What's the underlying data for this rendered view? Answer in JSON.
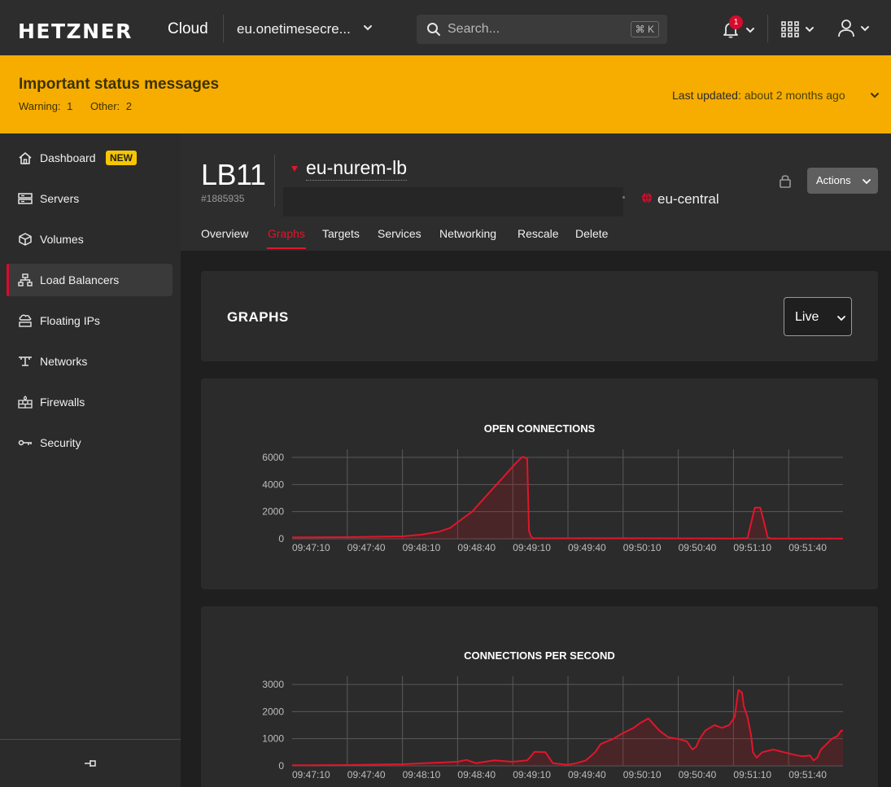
{
  "topbar": {
    "logo": "HETZNER",
    "product": "Cloud",
    "project": "eu.onetimesecre...",
    "search_placeholder": "Search...",
    "search_shortcut": "⌘ K",
    "notification_count": "1"
  },
  "banner": {
    "title": "Important status messages",
    "warning_label": "Warning:",
    "warning_count": "1",
    "other_label": "Other:",
    "other_count": "2",
    "updated_label": "Last updated:",
    "updated_value": "about 2 months ago"
  },
  "sidebar": {
    "items": [
      {
        "label": "Dashboard",
        "icon": "home-icon",
        "badge": "NEW"
      },
      {
        "label": "Servers",
        "icon": "server-icon"
      },
      {
        "label": "Volumes",
        "icon": "cube-icon"
      },
      {
        "label": "Load Balancers",
        "icon": "load-balancer-icon",
        "active": true
      },
      {
        "label": "Floating IPs",
        "icon": "floating-ip-icon"
      },
      {
        "label": "Networks",
        "icon": "network-icon"
      },
      {
        "label": "Firewalls",
        "icon": "firewall-icon"
      },
      {
        "label": "Security",
        "icon": "key-icon"
      }
    ]
  },
  "header": {
    "type": "LB11",
    "id": "#1885935",
    "name": "eu-nurem-lb",
    "location": "eu-central",
    "actions_label": "Actions",
    "tabs": [
      "Overview",
      "Graphs",
      "Targets",
      "Services",
      "Networking",
      "Rescale",
      "Delete"
    ],
    "active_tab": "Graphs"
  },
  "graphs": {
    "title": "GRAPHS",
    "range": "Live"
  },
  "colors": {
    "accent": "#d50c2d",
    "banner": "#f7ac00",
    "line": "#e0162b"
  },
  "chart_data": [
    {
      "type": "area",
      "title": "OPEN CONNECTIONS",
      "x": [
        "09:47:10",
        "09:47:40",
        "09:48:10",
        "09:48:40",
        "09:49:10",
        "09:49:40",
        "09:50:10",
        "09:50:40",
        "09:51:10",
        "09:51:40"
      ],
      "ytick_labels": [
        "0",
        "2000",
        "4000",
        "6000"
      ],
      "ylim": [
        0,
        6000
      ],
      "grid": true,
      "series": [
        {
          "points": [
            [
              0,
              100
            ],
            [
              30,
              120
            ],
            [
              60,
              180
            ],
            [
              70,
              300
            ],
            [
              80,
              520
            ],
            [
              86,
              800
            ],
            [
              90,
              1200
            ],
            [
              94,
              1600
            ],
            [
              98,
              2000
            ],
            [
              102,
              2600
            ],
            [
              106,
              3200
            ],
            [
              110,
              3800
            ],
            [
              114,
              4400
            ],
            [
              118,
              5000
            ],
            [
              122,
              5600
            ],
            [
              125,
              6000
            ],
            [
              126,
              6050
            ],
            [
              128,
              5900
            ],
            [
              129,
              600
            ],
            [
              130,
              200
            ],
            [
              131,
              50
            ],
            [
              240,
              20
            ],
            [
              248,
              50
            ],
            [
              250,
              1200
            ],
            [
              252,
              2300
            ],
            [
              255,
              2300
            ],
            [
              257,
              1200
            ],
            [
              259,
              100
            ],
            [
              261,
              20
            ],
            [
              300,
              20
            ]
          ]
        }
      ]
    },
    {
      "type": "area",
      "title": "CONNECTIONS PER SECOND",
      "x": [
        "09:47:10",
        "09:47:40",
        "09:48:10",
        "09:48:40",
        "09:49:10",
        "09:49:40",
        "09:50:10",
        "09:50:40",
        "09:51:10",
        "09:51:40"
      ],
      "ytick_labels": [
        "0",
        "1000",
        "2000",
        "3000"
      ],
      "ylim": [
        0,
        3000
      ],
      "grid": true,
      "series": [
        {
          "points": [
            [
              0,
              20
            ],
            [
              30,
              30
            ],
            [
              60,
              60
            ],
            [
              80,
              120
            ],
            [
              90,
              150
            ],
            [
              95,
              220
            ],
            [
              100,
              100
            ],
            [
              110,
              200
            ],
            [
              120,
              150
            ],
            [
              128,
              200
            ],
            [
              130,
              350
            ],
            [
              132,
              520
            ],
            [
              138,
              500
            ],
            [
              140,
              300
            ],
            [
              142,
              100
            ],
            [
              150,
              40
            ],
            [
              155,
              100
            ],
            [
              160,
              200
            ],
            [
              165,
              500
            ],
            [
              168,
              800
            ],
            [
              175,
              1000
            ],
            [
              180,
              1200
            ],
            [
              186,
              1400
            ],
            [
              190,
              1600
            ],
            [
              194,
              1750
            ],
            [
              196,
              1600
            ],
            [
              200,
              1300
            ],
            [
              205,
              1050
            ],
            [
              210,
              1000
            ],
            [
              215,
              900
            ],
            [
              218,
              600
            ],
            [
              220,
              700
            ],
            [
              222,
              1000
            ],
            [
              225,
              1300
            ],
            [
              230,
              1500
            ],
            [
              234,
              1400
            ],
            [
              238,
              1500
            ],
            [
              241,
              1800
            ],
            [
              243,
              2800
            ],
            [
              245,
              2700
            ],
            [
              246,
              2200
            ],
            [
              248,
              1800
            ],
            [
              250,
              1100
            ],
            [
              251,
              500
            ],
            [
              253,
              300
            ],
            [
              256,
              500
            ],
            [
              262,
              600
            ],
            [
              268,
              500
            ],
            [
              274,
              400
            ],
            [
              278,
              350
            ],
            [
              282,
              380
            ],
            [
              284,
              200
            ],
            [
              286,
              300
            ],
            [
              288,
              600
            ],
            [
              291,
              800
            ],
            [
              294,
              1000
            ],
            [
              297,
              1100
            ],
            [
              299,
              1300
            ],
            [
              300,
              1300
            ]
          ]
        }
      ]
    }
  ]
}
